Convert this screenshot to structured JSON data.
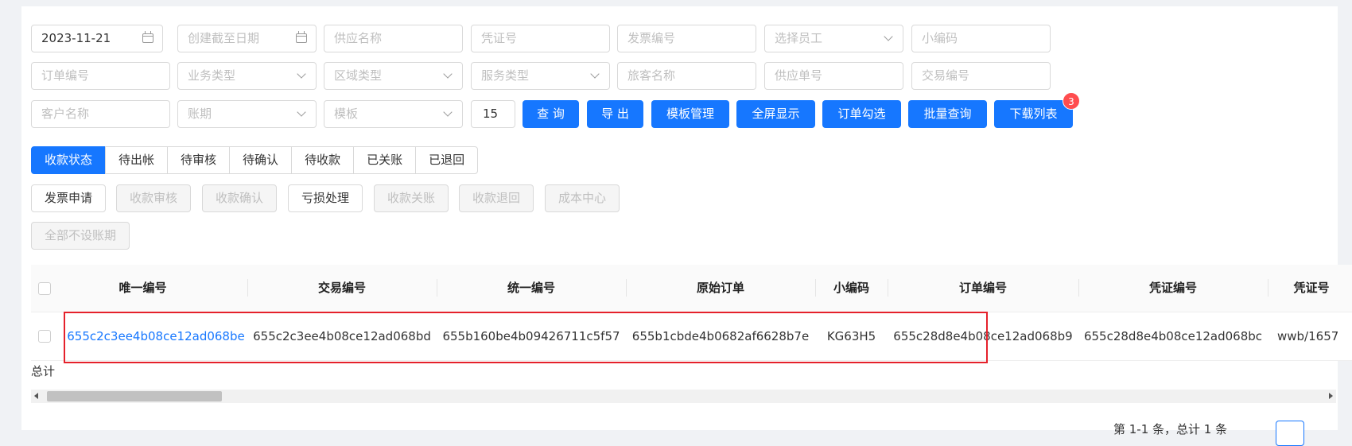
{
  "filters": {
    "row1": {
      "date": "2023-11-21",
      "end_date_placeholder": "创建截至日期",
      "supplier_name": "供应名称",
      "voucher_no": "凭证号",
      "invoice_no": "发票编号",
      "employee": "选择员工",
      "small_code": "小编码"
    },
    "row2": {
      "order_no": "订单编号",
      "business_type": "业务类型",
      "region_type": "区域类型",
      "service_type": "服务类型",
      "traveler_name": "旅客名称",
      "supply_order_no": "供应单号",
      "transaction_no": "交易编号"
    },
    "row3": {
      "customer_name": "客户名称",
      "billing_period": "账期",
      "template": "模板",
      "page_size": "15"
    }
  },
  "toolbar": {
    "query": "查 询",
    "export": "导 出",
    "template_manage": "模板管理",
    "fullscreen": "全屏显示",
    "order_select": "订单勾选",
    "batch_query": "批量查询",
    "download_list": "下载列表",
    "download_badge": "3"
  },
  "status_tabs": [
    "收款状态",
    "待出帐",
    "待审核",
    "待确认",
    "待收款",
    "已关账",
    "已退回"
  ],
  "actions": {
    "invoice_apply": "发票申请",
    "collection_review": "收款审核",
    "collection_confirm": "收款确认",
    "loss_handle": "亏损处理",
    "collection_close": "收款关账",
    "collection_return": "收款退回",
    "cost_center": "成本中心",
    "no_billing_period": "全部不设账期"
  },
  "table": {
    "headers": [
      "唯一编号",
      "交易编号",
      "统一编号",
      "原始订单",
      "小编码",
      "订单编号",
      "凭证编号",
      "凭证号"
    ],
    "row": [
      "655c2c3ee4b08ce12ad068be",
      "655c2c3ee4b08ce12ad068bd",
      "655b160be4b09426711c5f57",
      "655b1cbde4b0682af6628b7e",
      "KG63H5",
      "655c28d8e4b08ce12ad068b9",
      "655c28d8e4b08ce12ad068bc",
      "wwb/1657"
    ],
    "total_label": "总计"
  },
  "pagination": {
    "text": "第 1-1 条，总计 1 条"
  },
  "colors": {
    "primary": "#1677ff",
    "highlight": "#e5212b",
    "badge": "#ff4d4f"
  }
}
